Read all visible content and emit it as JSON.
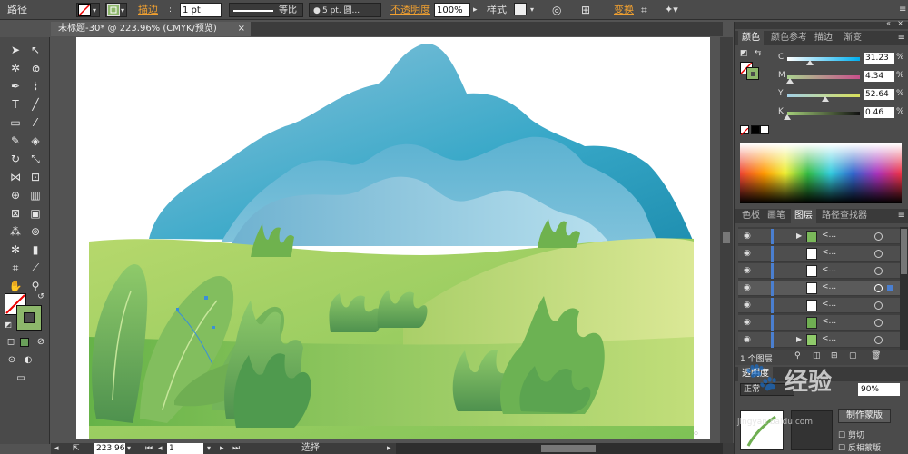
{
  "control_bar": {
    "selection_type": "路径",
    "stroke_label": "描边",
    "stroke_weight": "1 pt",
    "stroke_profile": "等比",
    "brush": "5 pt. 圆...",
    "opacity_label": "不透明度",
    "opacity_value": "100%",
    "style_label": "样式",
    "transform_label": "变换"
  },
  "document_tab": {
    "title": "未标题-30* @ 223.96% (CMYK/预览)",
    "close": "×"
  },
  "status_bar": {
    "zoom": "223.96",
    "artboard": "1",
    "mode": "选择"
  },
  "color_panel": {
    "tabs": [
      "颜色",
      "颜色参考",
      "描边",
      "渐变"
    ],
    "channels": [
      {
        "label": "C",
        "value": "31.23",
        "unit": "%",
        "level": 0.3123
      },
      {
        "label": "M",
        "value": "4.34",
        "unit": "%",
        "level": 0.0434
      },
      {
        "label": "Y",
        "value": "52.64",
        "unit": "%",
        "level": 0.5264
      },
      {
        "label": "K",
        "value": "0.46",
        "unit": "%",
        "level": 0.0046
      }
    ]
  },
  "layers_panel": {
    "tabs": [
      "色板",
      "画笔",
      "图层",
      "路径查找器"
    ],
    "footer": "1 个图层",
    "rows": [
      {
        "name": "<...",
        "toggle": "▶"
      },
      {
        "name": "<...",
        "toggle": ""
      },
      {
        "name": "<...",
        "toggle": ""
      },
      {
        "name": "<...",
        "toggle": ""
      },
      {
        "name": "<...",
        "toggle": ""
      },
      {
        "name": "<...",
        "toggle": ""
      },
      {
        "name": "<...",
        "toggle": "▶"
      }
    ]
  },
  "transparency_panel": {
    "title": "透明度",
    "mode": "正常",
    "opacity": "90%",
    "make_mask": "制作蒙版",
    "clip": "剪切",
    "invert_mask": "反相蒙版"
  },
  "watermark": {
    "text": "经验",
    "sub": "jingyan.baidu.com"
  },
  "colors": {
    "ui_bg": "#535353",
    "panel": "#4b4b4b",
    "mountain_dark": "#2a9fc2",
    "mountain_light": "#9fcfe3",
    "grass_light": "#cfe28a",
    "grass_dark": "#5a9f55",
    "fill_swatch": "#8db76b"
  }
}
